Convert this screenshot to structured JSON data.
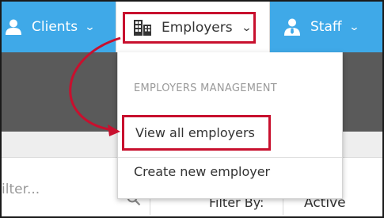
{
  "navbar": {
    "clients_label": "Clients",
    "employers_label": "Employers",
    "staff_label": "Staff",
    "color": "#3fa9e8"
  },
  "dropdown": {
    "header": "EMPLOYERS MANAGEMENT",
    "items": [
      {
        "label": "View all employers"
      },
      {
        "label": "Create new employer"
      }
    ]
  },
  "filters": {
    "search_placeholder": "ilter...",
    "filter_by_label": "Filter By:",
    "status_value": "Active"
  },
  "highlight_color": "#c8102e",
  "icons": [
    "user-icon",
    "building-icon",
    "staff-icon",
    "chevron-down-icon",
    "search-icon"
  ]
}
